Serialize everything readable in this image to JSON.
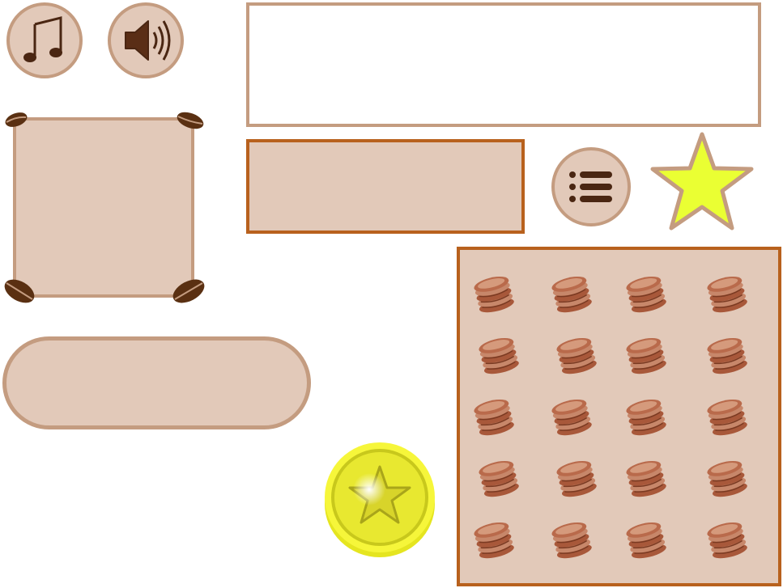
{
  "icons": {
    "music": "music-note-icon",
    "sound": "speaker-icon",
    "menu": "list-menu-icon",
    "star": "star-icon",
    "coin": "star-coin-icon",
    "cookie": "cookie-stack-icon",
    "bean": "coffee-bean-icon"
  },
  "colors": {
    "panel_fill": "#e2c9b9",
    "border_tan": "#c49c80",
    "border_orange": "#b8611d",
    "icon_brown": "#4a2612",
    "star_yellow": "#eaff33",
    "coin_yellow": "#f2f23a"
  },
  "grid": {
    "rows": 5,
    "columns": 4
  }
}
